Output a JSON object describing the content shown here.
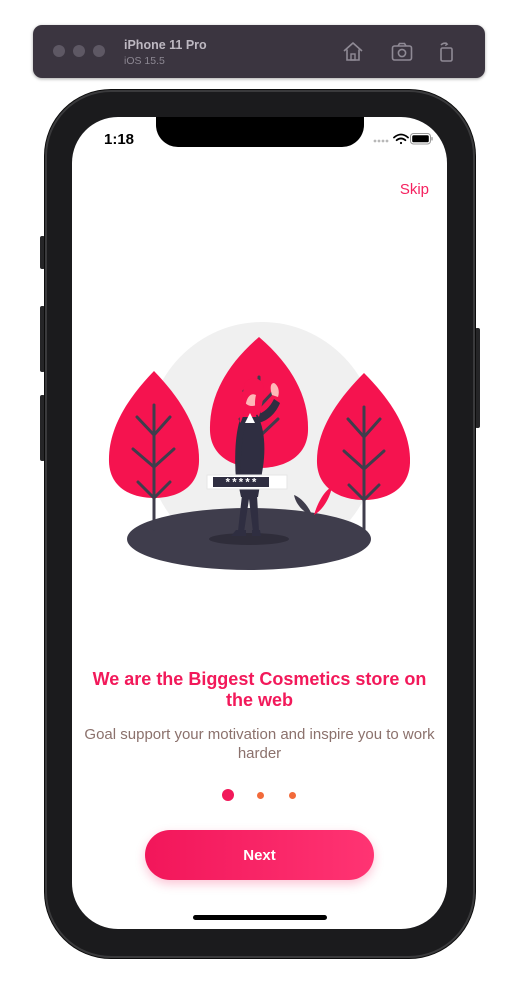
{
  "simulator": {
    "device_name": "iPhone 11 Pro",
    "os_version": "iOS 15.5",
    "toolbar_icons": [
      "home-icon",
      "screenshot-icon",
      "rotate-icon"
    ]
  },
  "status_bar": {
    "time": "1:18",
    "icons": [
      "cellular-dots-icon",
      "wifi-icon",
      "battery-icon"
    ]
  },
  "onboarding": {
    "skip_label": "Skip",
    "headline": "We are the Biggest Cosmetics store on the web",
    "subtitle": "Goal support your motivation and inspire you to work harder",
    "illustration_password": "*****",
    "page_count": 3,
    "current_page": 1,
    "next_label": "Next"
  },
  "colors": {
    "accent": "#f2195a",
    "dot_inactive": "#f26a3a",
    "subtitle": "#8b716c"
  }
}
